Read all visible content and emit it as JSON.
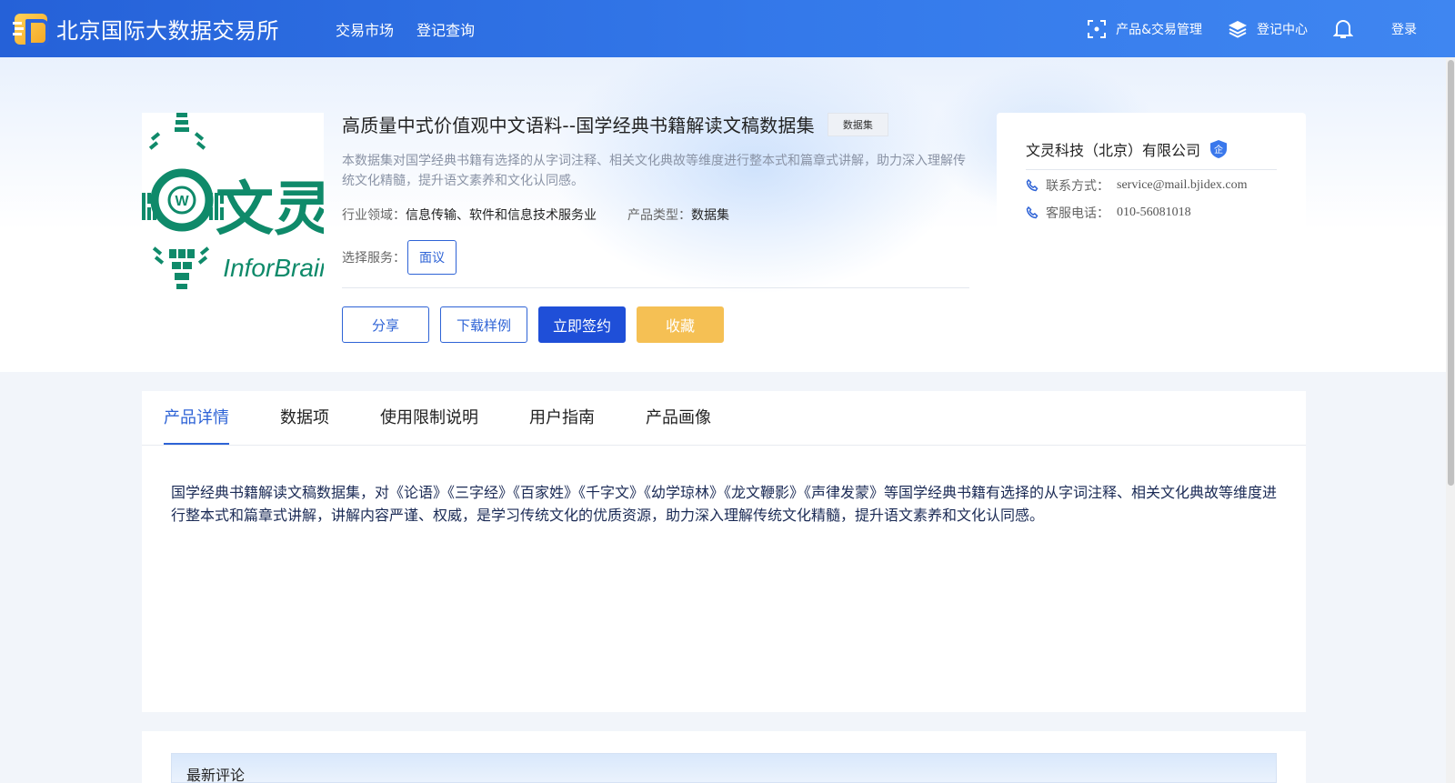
{
  "brand": {
    "name": "北京国际大数据交易所"
  },
  "nav": {
    "links": [
      "交易市场",
      "登记查询"
    ],
    "product_mgmt": "产品&交易管理",
    "register_center": "登记中心",
    "login": "登录"
  },
  "product": {
    "logo_text": "InforBrain",
    "title": "高质量中式价值观中文语料--国学经典书籍解读文稿数据集",
    "tag": "数据集",
    "description": "本数据集对国学经典书籍有选择的从字词注释、相关文化典故等维度进行整本式和篇章式讲解，助力深入理解传统文化精髓，提升语文素养和文化认同感。",
    "industry_label": "行业领域：",
    "industry_value": "信息传输、软件和信息技术服务业",
    "type_label": "产品类型：",
    "type_value": "数据集",
    "service_label": "选择服务：",
    "service_option": "面议",
    "buttons": {
      "share": "分享",
      "download_sample": "下载样例",
      "sign_now": "立即签约",
      "favorite": "收藏"
    }
  },
  "company": {
    "name": "文灵科技（北京）有限公司",
    "badge": "企",
    "contact_label": "联系方式：",
    "contact_value": "service@mail.bjidex.com",
    "phone_label": "客服电话：",
    "phone_value": "010-56081018"
  },
  "tabs": [
    {
      "label": "产品详情",
      "active": true
    },
    {
      "label": "数据项",
      "active": false
    },
    {
      "label": "使用限制说明",
      "active": false
    },
    {
      "label": "用户指南",
      "active": false
    },
    {
      "label": "产品画像",
      "active": false
    }
  ],
  "detail": {
    "text": "国学经典书籍解读文稿数据集，对《论语》《三字经》《百家姓》《千字文》《幼学琼林》《龙文鞭影》《声律发蒙》等国学经典书籍有选择的从字词注释、相关文化典故等维度进行整本式和篇章式讲解，讲解内容严谨、权威，是学习传统文化的优质资源，助力深入理解传统文化精髓，提升语文素养和文化认同感。"
  },
  "comments": {
    "title": "最新评论"
  },
  "colors": {
    "primary": "#1f4fd8",
    "accent_blue": "#2e63d6",
    "favorite": "#f5c054",
    "logo_green": "#0f8a6a"
  }
}
